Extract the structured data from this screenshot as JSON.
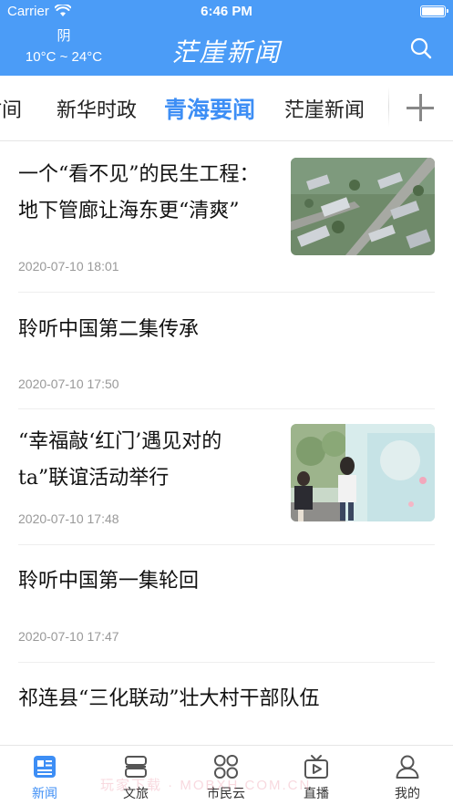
{
  "status_bar": {
    "carrier": "Carrier",
    "time": "6:46 PM"
  },
  "header": {
    "weather_condition": "阴",
    "temperature_range": "10°C ~ 24°C",
    "app_title": "茫崖新闻"
  },
  "tabs": [
    {
      "label": "时间"
    },
    {
      "label": "新华时政"
    },
    {
      "label": "青海要闻",
      "active": true
    },
    {
      "label": "茫崖新闻"
    }
  ],
  "news": [
    {
      "title": "一个“看不见”的民生工程：地下管廊让海东更“清爽”",
      "date": "2020-07-10 18:01",
      "thumbnail": "aerial-city-photo"
    },
    {
      "title": "聆听中国第二集传承",
      "date": "2020-07-10 17:50"
    },
    {
      "title": "“幸福敲‘红门’遇见对的ta”联谊活动举行",
      "date": "2020-07-10 17:48",
      "thumbnail": "painting-wall-photo"
    },
    {
      "title": "聆听中国第一集轮回",
      "date": "2020-07-10 17:47"
    },
    {
      "title": "祁连县“三化联动”壮大村干部队伍",
      "date": ""
    }
  ],
  "tabbar": [
    {
      "label": "新闻",
      "icon": "news-icon",
      "active": true
    },
    {
      "label": "文旅",
      "icon": "culture-travel-icon"
    },
    {
      "label": "市民云",
      "icon": "citizen-cloud-icon"
    },
    {
      "label": "直播",
      "icon": "live-tv-icon"
    },
    {
      "label": "我的",
      "icon": "profile-icon"
    }
  ],
  "watermark": "玩家下载 · MOBXH.COM.CN",
  "colors": {
    "brand_blue": "#4b9cf7",
    "active_tab": "#3d8ef5",
    "date_gray": "#999999"
  }
}
